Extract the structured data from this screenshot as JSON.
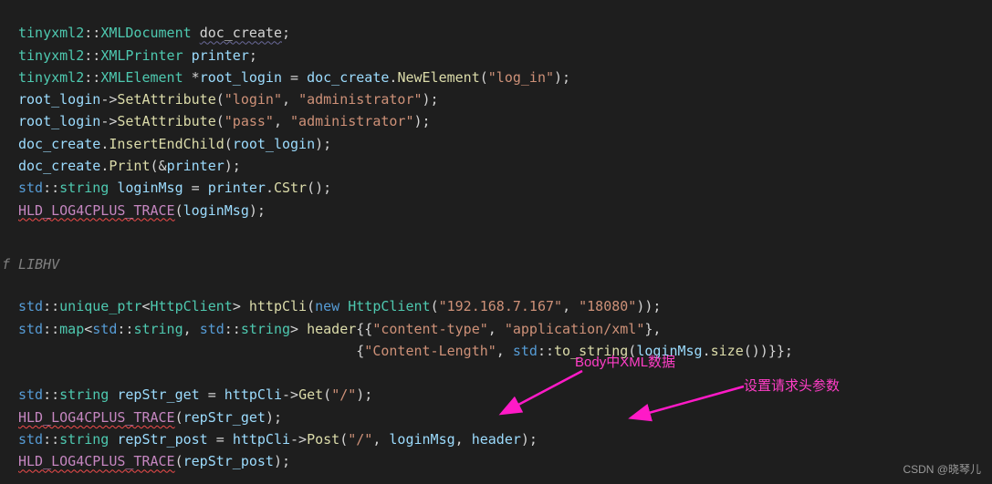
{
  "ns": "tinyxml2",
  "types": {
    "xmldoc": "XMLDocument",
    "xmlprinter": "XMLPrinter",
    "xmlelement": "XMLElement",
    "httpclient": "HttpClient",
    "string": "string",
    "unique_ptr": "unique_ptr",
    "map": "map"
  },
  "std": "std",
  "vars": {
    "doc_create": "doc_create",
    "printer": "printer",
    "root_login": "root_login",
    "loginMsg": "loginMsg",
    "httpCli": "httpCli",
    "header": "header",
    "repStr_get": "repStr_get",
    "repStr_post": "repStr_post"
  },
  "funcs": {
    "NewElement": "NewElement",
    "SetAttribute": "SetAttribute",
    "InsertEndChild": "InsertEndChild",
    "Print": "Print",
    "CStr": "CStr",
    "Get": "Get",
    "Post": "Post",
    "to_string": "to_string",
    "size": "size"
  },
  "macros": {
    "trace": "HLD_LOG4CPLUS_TRACE"
  },
  "kw": {
    "new": "new"
  },
  "strings": {
    "log_in": "\"log_in\"",
    "login_key": "\"login\"",
    "admin": "\"administrator\"",
    "pass_key": "\"pass\"",
    "ip": "\"192.168.7.167\"",
    "port": "\"18080\"",
    "ct_key": "\"content-type\"",
    "ct_val": "\"application/xml\"",
    "cl_key": "\"Content-Length\"",
    "slash": "\"/\""
  },
  "ifdef": {
    "label": "f LIBHV"
  },
  "annotations": {
    "body_xml": "Body中XML数据",
    "set_header": "设置请求头参数"
  },
  "watermark": "CSDN @晓琴儿"
}
